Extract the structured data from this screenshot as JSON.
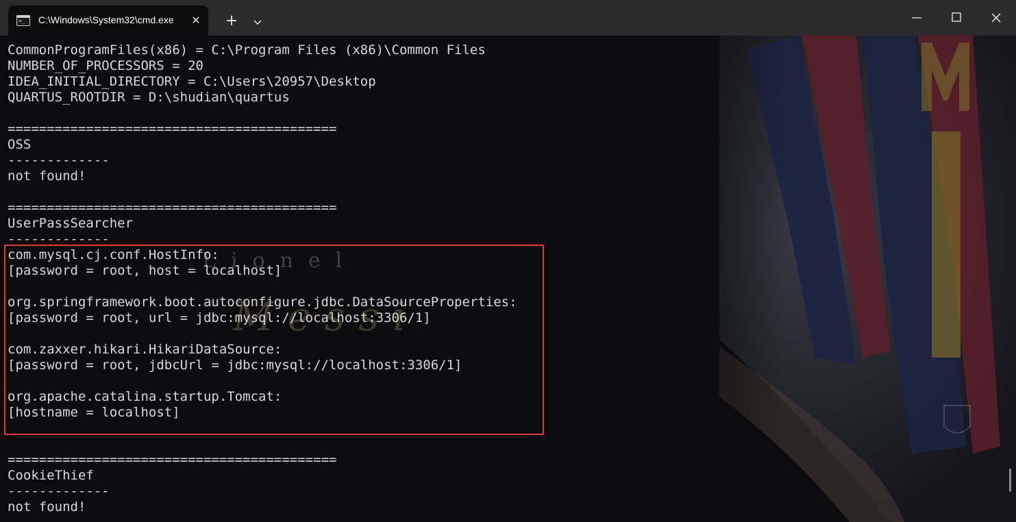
{
  "window": {
    "tab_title": "C:\\Windows\\System32\\cmd.exe",
    "tab_close": "✕",
    "new_tab": "+"
  },
  "console": {
    "lines": [
      "CommonProgramFiles(x86) = C:\\Program Files (x86)\\Common Files",
      "NUMBER_OF_PROCESSORS = 20",
      "IDEA_INITIAL_DIRECTORY = C:\\Users\\20957\\Desktop",
      "QUARTUS_ROOTDIR = D:\\shudian\\quartus",
      "",
      "==========================================",
      "OSS",
      "-------------",
      "not found!",
      "",
      "==========================================",
      "UserPassSearcher",
      "-------------",
      "com.mysql.cj.conf.HostInfo:",
      "[password = root, host = localhost]",
      "",
      "org.springframework.boot.autoconfigure.jdbc.DataSourceProperties:",
      "[password = root, url = jdbc:mysql://localhost:3306/1]",
      "",
      "com.zaxxer.hikari.HikariDataSource:",
      "[password = root, jdbcUrl = jdbc:mysql://localhost:3306/1]",
      "",
      "org.apache.catalina.startup.Tomcat:",
      "[hostname = localhost]",
      "",
      "",
      "==========================================",
      "CookieThief",
      "-------------",
      "not found!"
    ]
  },
  "wallpaper": {
    "text_line1": "Lionel",
    "text_line2": "Messi"
  },
  "colors": {
    "titlebar": "#2b2b2b",
    "console_bg": "#0c0c0f",
    "console_text": "#d9d9d9",
    "highlight": "#e03a3a"
  }
}
